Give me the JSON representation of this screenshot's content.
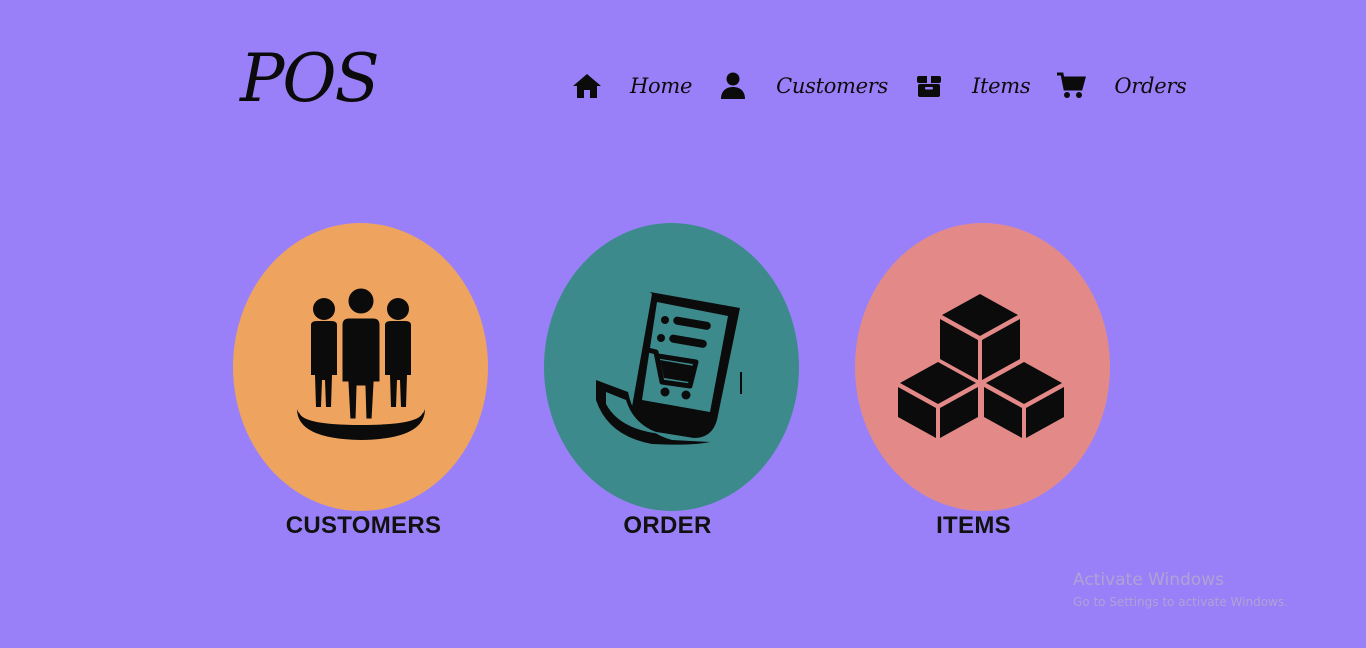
{
  "header": {
    "logo": "POS",
    "nav": [
      {
        "icon": "home-icon",
        "label": "Home"
      },
      {
        "icon": "user-icon",
        "label": "Customers"
      },
      {
        "icon": "box-icon",
        "label": "Items"
      },
      {
        "icon": "cart-icon",
        "label": "Orders"
      }
    ]
  },
  "cards": [
    {
      "icon": "customers-group-icon",
      "label": "CUSTOMERS",
      "color": "#eea45f"
    },
    {
      "icon": "order-receipt-cart-icon",
      "label": "ORDER",
      "color": "#3d8a8d"
    },
    {
      "icon": "boxes-stack-icon",
      "label": "ITEMS",
      "color": "#e38a89"
    }
  ],
  "colors": {
    "background": "#9a80f8"
  },
  "watermark": {
    "title": "Activate Windows",
    "subtitle": "Go to Settings to activate Windows."
  }
}
